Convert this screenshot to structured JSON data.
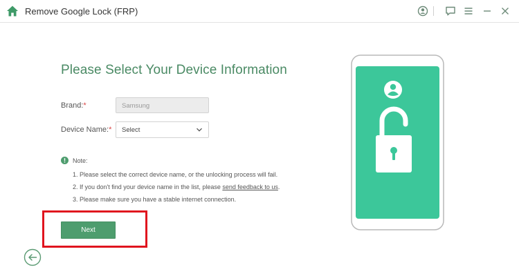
{
  "window": {
    "title": "Remove Google Lock (FRP)",
    "icons": [
      "home-icon",
      "user-account-icon",
      "feedback-icon",
      "menu-icon",
      "minimize-icon",
      "close-icon"
    ]
  },
  "main": {
    "heading": "Please Select Your Device Information",
    "brand": {
      "label": "Brand:",
      "required_mark": "*",
      "value": "Samsung"
    },
    "device_name": {
      "label": "Device Name:",
      "required_mark": "*",
      "value": "Select"
    },
    "note": {
      "title": "Note:",
      "line1": "1. Please select the correct device name, or the unlocking process will fail.",
      "line2_prefix": "2. If you don't find your device name in the list, please ",
      "line2_link": "send feedback to us",
      "line2_suffix": ".",
      "line3": "3. Please make sure you have a stable internet connection."
    },
    "next_label": "Next"
  },
  "colors": {
    "accent": "#4e9d6e",
    "heading": "#4a8a64",
    "phone_screen": "#3cc79a",
    "highlight": "#e0141e"
  }
}
